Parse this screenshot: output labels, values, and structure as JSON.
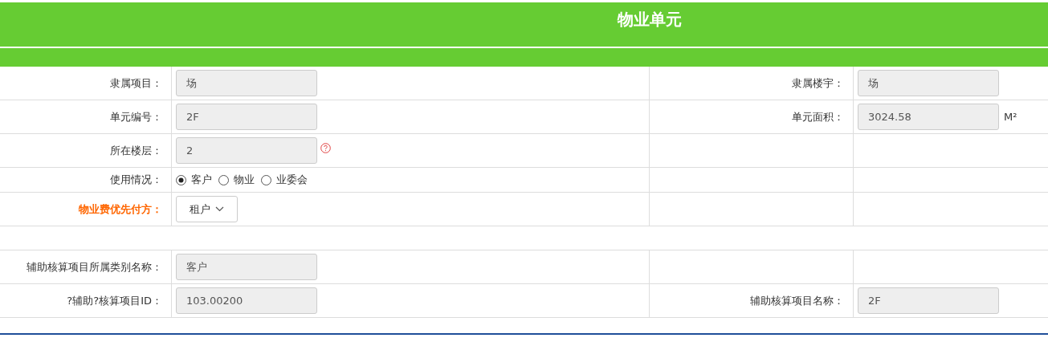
{
  "title": "物业单元",
  "rows": [
    {
      "kind": "pair",
      "left": {
        "label": "隶属项目：",
        "kind": "field",
        "value": "场"
      },
      "right": {
        "label": "隶属楼宇：",
        "kind": "field",
        "value": "场"
      }
    },
    {
      "kind": "pair",
      "left": {
        "label": "单元编号：",
        "kind": "field",
        "value": "2F"
      },
      "right": {
        "label": "单元面积：",
        "kind": "field",
        "value": "3024.58",
        "unit": "M²"
      }
    },
    {
      "kind": "pair",
      "left": {
        "label": "所在楼层：",
        "kind": "field",
        "value": "2",
        "help": true
      }
    },
    {
      "kind": "pair",
      "left": {
        "label": "使用情况：",
        "kind": "radio",
        "options": [
          {
            "label": "客户",
            "selected": true
          },
          {
            "label": "物业",
            "selected": false
          },
          {
            "label": "业委会",
            "selected": false
          }
        ]
      }
    },
    {
      "kind": "pair",
      "left": {
        "label": "物业费优先付方：",
        "kind": "select",
        "value": "租户",
        "emphasis": true
      }
    },
    {
      "kind": "spacer"
    },
    {
      "kind": "pair",
      "left": {
        "label": "辅助核算项目所属类别名称：",
        "kind": "field",
        "value": "客户"
      }
    },
    {
      "kind": "pair",
      "left": {
        "label": "?辅助?核算项目ID：",
        "kind": "field",
        "value": "103.00200"
      },
      "right": {
        "label": "辅助核算项目名称：",
        "kind": "field",
        "value": "2F"
      }
    }
  ]
}
